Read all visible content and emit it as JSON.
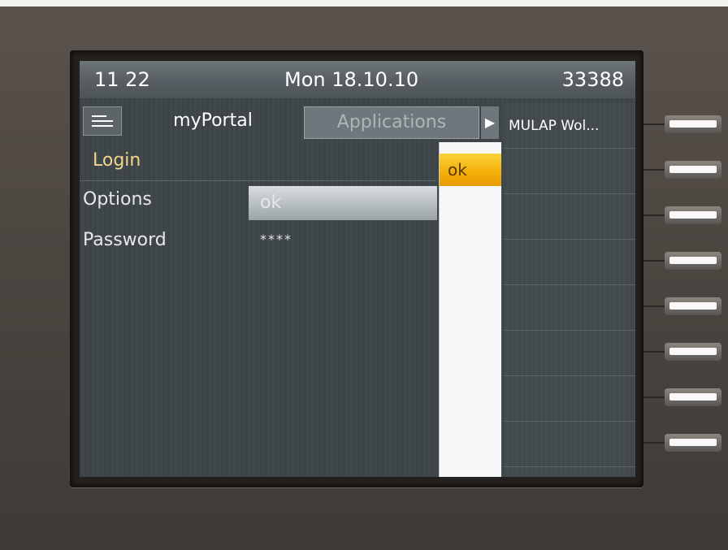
{
  "status_bar": {
    "time": "11 22",
    "date": "Mon 18.10.10",
    "extension": "33388"
  },
  "tabs": {
    "menu_icon": "menu-lines-icon",
    "active": "myPortal",
    "inactive": "Applications",
    "arrow": "▶"
  },
  "form": {
    "title": "Login",
    "options_label": "Options",
    "options_value": "ok",
    "password_label": "Password",
    "password_value": "****"
  },
  "dropdown": {
    "options": [
      "ok"
    ],
    "selected": "ok"
  },
  "keys": [
    {
      "label": "MULAP Wol..."
    },
    {
      "label": ""
    },
    {
      "label": ""
    },
    {
      "label": ""
    },
    {
      "label": ""
    },
    {
      "label": ""
    },
    {
      "label": ""
    },
    {
      "label": ""
    }
  ],
  "colors": {
    "title": "#f2d58a",
    "selected_option": "#f4b20a",
    "screen_bg": "#3d4448"
  }
}
